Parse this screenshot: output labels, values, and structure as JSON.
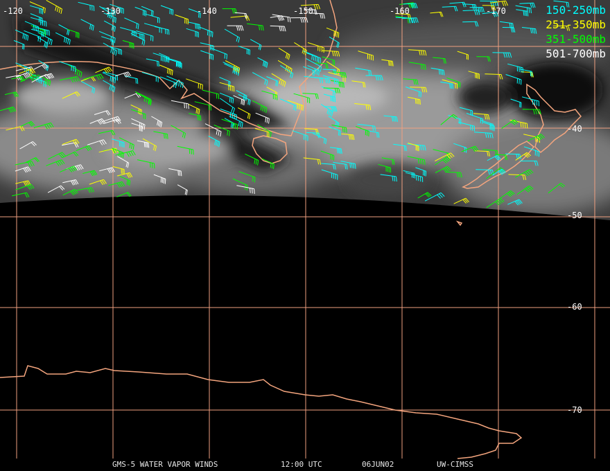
{
  "lon_labels": [
    "-120",
    "-130",
    "-140",
    "-150",
    "-160",
    "-170"
  ],
  "lat_labels": [
    "-40",
    "-50",
    "-60",
    "-70"
  ],
  "legend": [
    {
      "label": "150-250mb",
      "color": "#00ffff"
    },
    {
      "label": "251-350mb",
      "color": "#ffff00"
    },
    {
      "label": "351-500mb",
      "color": "#00ff00"
    },
    {
      "label": "501-700mb",
      "color": "#ffffff"
    }
  ],
  "footer": {
    "satellite": "GMS-5 WATER VAPOR WINDS",
    "time": "12:00 UTC",
    "date": "06JUN02",
    "source": "UW-CIMSS"
  },
  "colors": {
    "grid": "#f0a080",
    "coastline": "#f4a57e",
    "background": "#000000"
  }
}
